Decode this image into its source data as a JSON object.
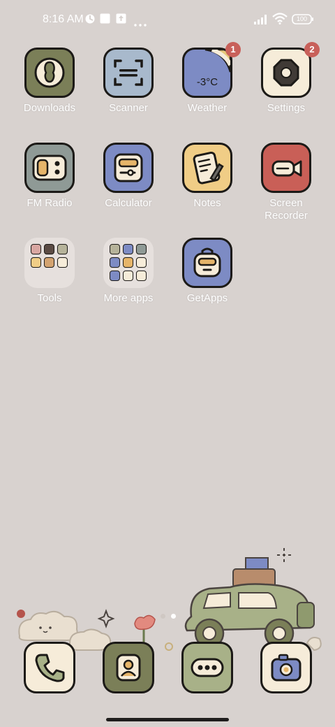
{
  "status_bar": {
    "time": "8:16 AM",
    "battery": "100",
    "icons": [
      "vpn-icon",
      "square-icon",
      "upload-icon",
      "more-dots-icon",
      "signal-icon",
      "wifi-icon",
      "battery-icon"
    ]
  },
  "apps": [
    {
      "label": "Downloads",
      "icon": "downloads-icon",
      "badge": null
    },
    {
      "label": "Scanner",
      "icon": "scanner-icon",
      "badge": null
    },
    {
      "label": "Weather",
      "icon": "weather-icon",
      "badge": "1",
      "temperature": "-3°C"
    },
    {
      "label": "Settings",
      "icon": "settings-icon",
      "badge": "2"
    },
    {
      "label": "FM Radio",
      "icon": "radio-icon",
      "badge": null
    },
    {
      "label": "Calculator",
      "icon": "calculator-icon",
      "badge": null
    },
    {
      "label": "Notes",
      "icon": "notes-icon",
      "badge": null
    },
    {
      "label": "Screen\nRecorder",
      "icon": "screen-recorder-icon",
      "badge": null
    },
    {
      "label": "Tools",
      "icon": "folder-icon",
      "badge": null
    },
    {
      "label": "More apps",
      "icon": "folder-icon",
      "badge": null
    },
    {
      "label": "GetApps",
      "icon": "getapps-icon",
      "badge": null
    }
  ],
  "dock": [
    {
      "icon": "phone-icon"
    },
    {
      "icon": "contacts-icon"
    },
    {
      "icon": "messages-icon"
    },
    {
      "icon": "camera-icon"
    }
  ],
  "colors": {
    "background": "#d8d2cf",
    "olive": "#7b7f58",
    "blue_gray": "#a8b9cc",
    "periwinkle": "#7d8bc4",
    "cream": "#f6ecd9",
    "slate": "#8f9a96",
    "mustard": "#f0cd86",
    "brick": "#c95f57",
    "sage": "#a8b188",
    "badge": "#c8605a"
  }
}
